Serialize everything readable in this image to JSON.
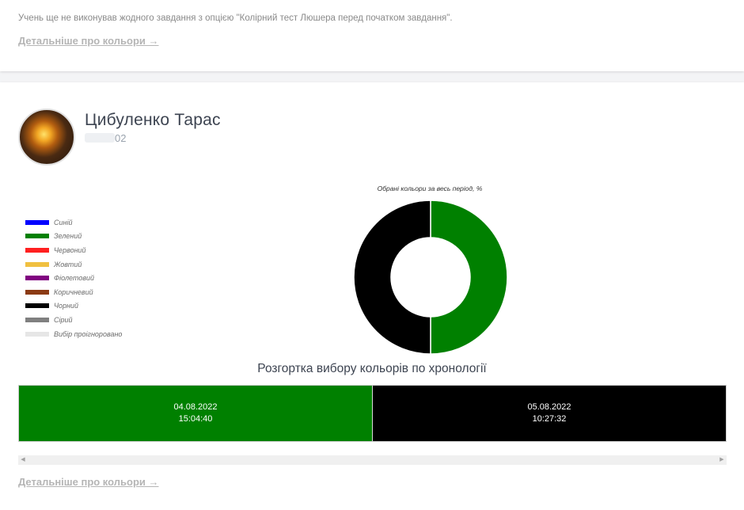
{
  "top_card": {
    "notice": "Учень ще не виконував жодного завдання з опцією \"Колірний тест Люшера перед початком завдання\".",
    "more_link": "Детальніше про кольори →"
  },
  "student": {
    "name": "Цибуленко Тарас",
    "id_suffix": "02"
  },
  "chart_data": {
    "type": "pie",
    "title": "Обрані кольори за весь період, %",
    "legend": [
      {
        "label": "Синій",
        "color": "#0000ff"
      },
      {
        "label": "Зелений",
        "color": "#008000"
      },
      {
        "label": "Червоний",
        "color": "#ff2020"
      },
      {
        "label": "Жовтий",
        "color": "#f0c040"
      },
      {
        "label": "Фіолетовий",
        "color": "#800080"
      },
      {
        "label": "Коричневий",
        "color": "#8b3a14"
      },
      {
        "label": "Чорний",
        "color": "#000000"
      },
      {
        "label": "Сірий",
        "color": "#808080"
      },
      {
        "label": "Вибір проігноровано",
        "color": "#e6e6e6"
      }
    ],
    "slices": [
      {
        "label": "Зелений",
        "value": 50,
        "color": "#008000"
      },
      {
        "label": "Чорний",
        "value": 50,
        "color": "#000000"
      }
    ]
  },
  "timeline": {
    "title": "Розгортка вибору кольорів по хронології",
    "entries": [
      {
        "date": "04.08.2022",
        "time": "15:04:40",
        "color": "#008000"
      },
      {
        "date": "05.08.2022",
        "time": "10:27:32",
        "color": "#000000"
      }
    ]
  },
  "bottom_link": "Детальніше про кольори →"
}
